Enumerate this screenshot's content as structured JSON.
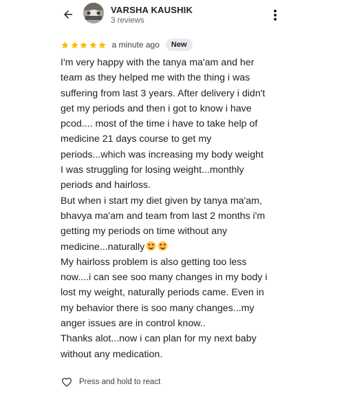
{
  "header": {
    "back_icon": "arrow-left-icon",
    "reviewer_name": "VARSHA KAUSHIK",
    "review_count": "3 reviews",
    "menu_icon": "more-vert-icon"
  },
  "rating": {
    "stars": 5,
    "star_color": "#fbbc04",
    "time": "a minute ago",
    "badge": "New"
  },
  "review": {
    "lines": [
      "I'm very happy with the tanya ma'am and her",
      "team as they helped me with the thing i was",
      "suffering from last 3 years. After delivery i didn't",
      "get my periods and then i got to know i have",
      "pcod.... most of the time i have to take help of",
      "medicine 21 days course to get my",
      "periods...which was increasing my body weight",
      "I was struggling for losing weight...monthly",
      "periods and hairloss.",
      "But when i start my diet given by tanya ma'am,",
      "bhavya ma'am and team from last 2 months i'm",
      "getting my periods on time without any",
      "medicine...naturally",
      "My hairloss problem is also getting too less",
      "now....i can see soo many changes in my body i",
      "lost my weight, naturally periods came. Even in",
      "my behavior there is soo many changes...my",
      "anger issues are in control know..",
      "Thanks alot...now i can plan for my next baby",
      "without any medication."
    ],
    "emoji_icon": "smiling-face-with-heart-eyes-icon"
  },
  "react": {
    "icon": "heart-outline-icon",
    "label": "Press and hold to react"
  }
}
